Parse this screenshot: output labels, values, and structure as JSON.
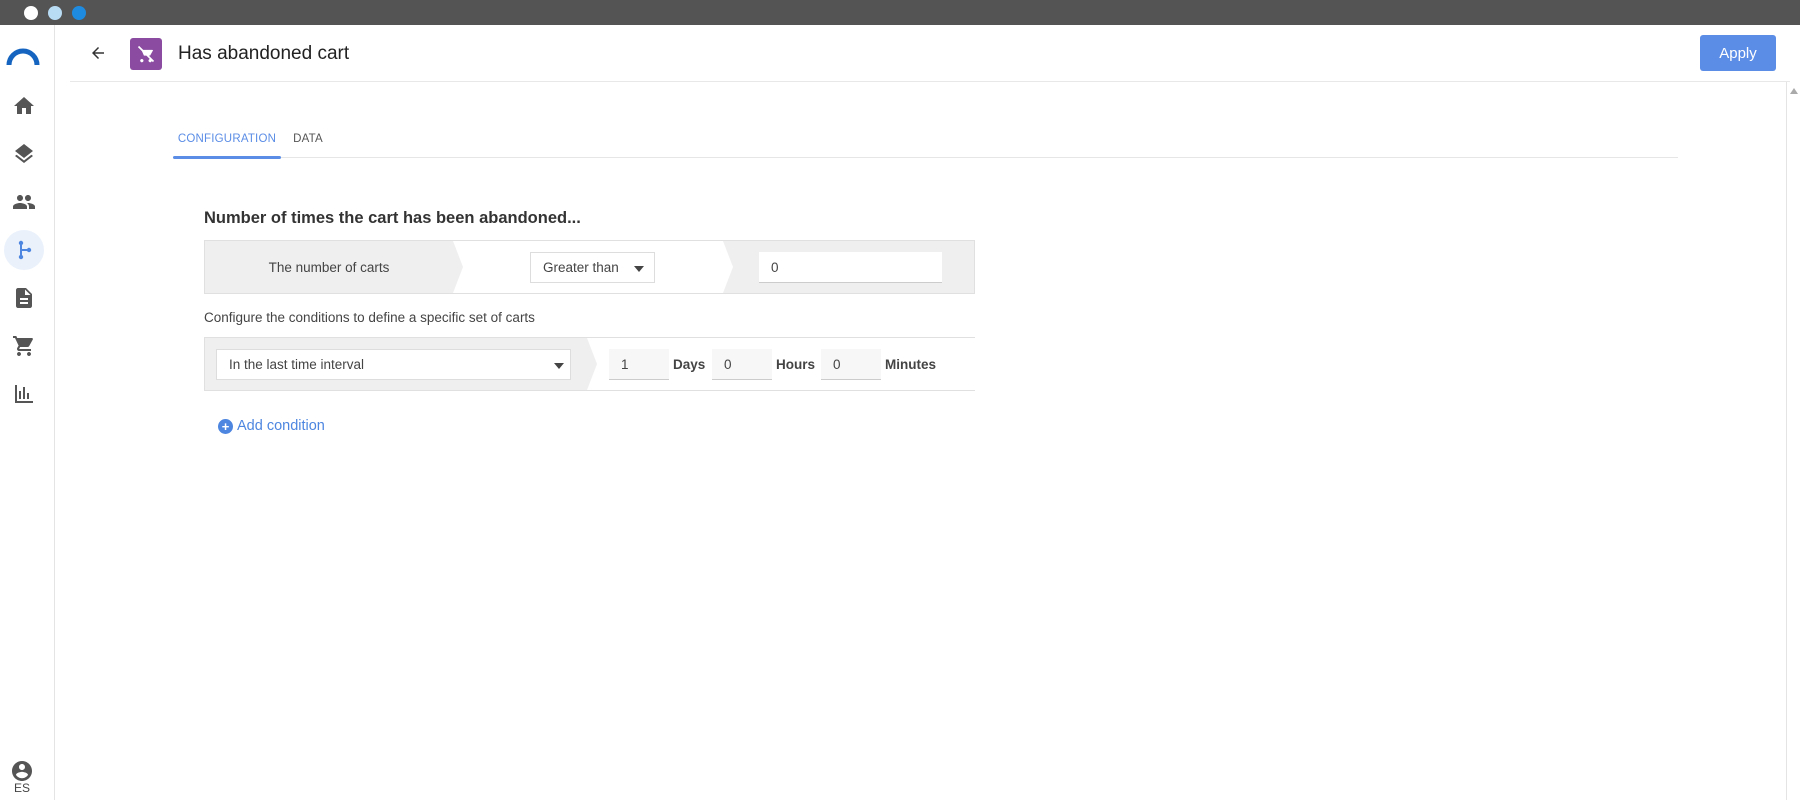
{
  "sidebar": {
    "items": [
      {
        "name": "home",
        "icon": "home-icon"
      },
      {
        "name": "layers",
        "icon": "layers-icon"
      },
      {
        "name": "people",
        "icon": "people-icon"
      },
      {
        "name": "flow",
        "icon": "flow-branch-icon",
        "active": true
      },
      {
        "name": "document",
        "icon": "document-icon"
      },
      {
        "name": "cart",
        "icon": "cart-icon"
      },
      {
        "name": "analytics",
        "icon": "bar-chart-icon"
      }
    ],
    "language": "ES"
  },
  "header": {
    "title": "Has abandoned cart",
    "apply_label": "Apply",
    "badge_color": "#8a4ba0",
    "accent_color": "#5b8de6"
  },
  "tabs": [
    {
      "label": "CONFIGURATION",
      "active": true
    },
    {
      "label": "DATA",
      "active": false
    }
  ],
  "config": {
    "section_title": "Number of times the cart has been abandoned...",
    "count_label": "The number of carts",
    "operator": "Greater than",
    "count_value": "0",
    "conditions_hint": "Configure the conditions to define a specific set of carts",
    "interval_select": "In the last time interval",
    "days_value": "1",
    "days_label": "Days",
    "hours_value": "0",
    "hours_label": "Hours",
    "minutes_value": "0",
    "minutes_label": "Minutes",
    "add_condition_label": "Add condition"
  }
}
